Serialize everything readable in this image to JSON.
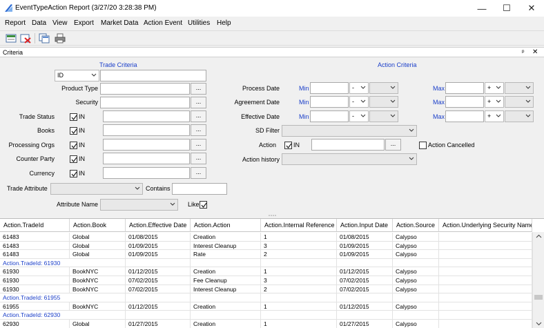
{
  "window": {
    "title": "EventTypeAction Report (3/27/20 3:28:38 PM)",
    "controls": [
      "—",
      "☐",
      "✕"
    ]
  },
  "menu": [
    "Report",
    "Data",
    "View",
    "Export",
    "Market Data",
    "Action Event",
    "Utilities",
    "Help"
  ],
  "toolbar_icons": [
    "load-icon",
    "delete-icon",
    "copy-icon",
    "print-icon"
  ],
  "criteria_panel": {
    "title": "Criteria",
    "pin": "ᵖ",
    "close": "✕"
  },
  "trade_criteria": {
    "header": "Trade Criteria",
    "id_select": "ID",
    "product_type": "Product Type",
    "security": "Security",
    "trade_status": "Trade Status",
    "books": "Books",
    "processing_orgs": "Processing Orgs",
    "counter_party": "Counter Party",
    "currency": "Currency",
    "in_label": "IN",
    "trade_attribute": "Trade Attribute",
    "contains": "Contains",
    "attribute_name": "Attribute Name",
    "like": "Like",
    "ellipsis": "..."
  },
  "action_criteria": {
    "header": "Action Criteria",
    "process_date": "Process Date",
    "agreement_date": "Agreement Date",
    "effective_date": "Effective Date",
    "min": "Min",
    "max": "Max",
    "minus": "-",
    "plus": "+",
    "sd_filter": "SD Filter",
    "action": "Action",
    "in_label": "IN",
    "action_cancelled": "Action Cancelled",
    "action_history": "Action history",
    "ellipsis": "..."
  },
  "grid": {
    "columns": [
      "Action.TradeId",
      "Action.Book",
      "Action.Effective Date",
      "Action.Action",
      "Action.Internal Reference",
      "Action.Input Date",
      "Action.Source",
      "Action.Underlying Security Name"
    ],
    "rows": [
      {
        "type": "data",
        "cells": [
          "61483",
          "Global",
          "01/08/2015",
          "Creation",
          "1",
          "01/08/2015",
          "Calypso",
          ""
        ]
      },
      {
        "type": "data",
        "cells": [
          "61483",
          "Global",
          "01/09/2015",
          "Interest Cleanup",
          "3",
          "01/09/2015",
          "Calypso",
          ""
        ]
      },
      {
        "type": "data",
        "cells": [
          "61483",
          "Global",
          "01/09/2015",
          "Rate",
          "2",
          "01/09/2015",
          "Calypso",
          ""
        ]
      },
      {
        "type": "group",
        "label": "Action.TradeId: 61930"
      },
      {
        "type": "data",
        "cells": [
          "61930",
          "BookNYC",
          "01/12/2015",
          "Creation",
          "1",
          "01/12/2015",
          "Calypso",
          ""
        ]
      },
      {
        "type": "data",
        "cells": [
          "61930",
          "BookNYC",
          "07/02/2015",
          "Fee Cleanup",
          "3",
          "07/02/2015",
          "Calypso",
          ""
        ]
      },
      {
        "type": "data",
        "cells": [
          "61930",
          "BookNYC",
          "07/02/2015",
          "Interest Cleanup",
          "2",
          "07/02/2015",
          "Calypso",
          ""
        ]
      },
      {
        "type": "group",
        "label": "Action.TradeId: 61955"
      },
      {
        "type": "data",
        "cells": [
          "61955",
          "BookNYC",
          "01/12/2015",
          "Creation",
          "1",
          "01/12/2015",
          "Calypso",
          ""
        ]
      },
      {
        "type": "group",
        "label": "Action.TradeId: 62930"
      },
      {
        "type": "data",
        "cells": [
          "62930",
          "Global",
          "01/27/2015",
          "Creation",
          "1",
          "01/27/2015",
          "Calypso",
          ""
        ]
      }
    ]
  },
  "colors": {
    "accent_blue": "#1a3ec9",
    "background": "#f0f0f0"
  }
}
